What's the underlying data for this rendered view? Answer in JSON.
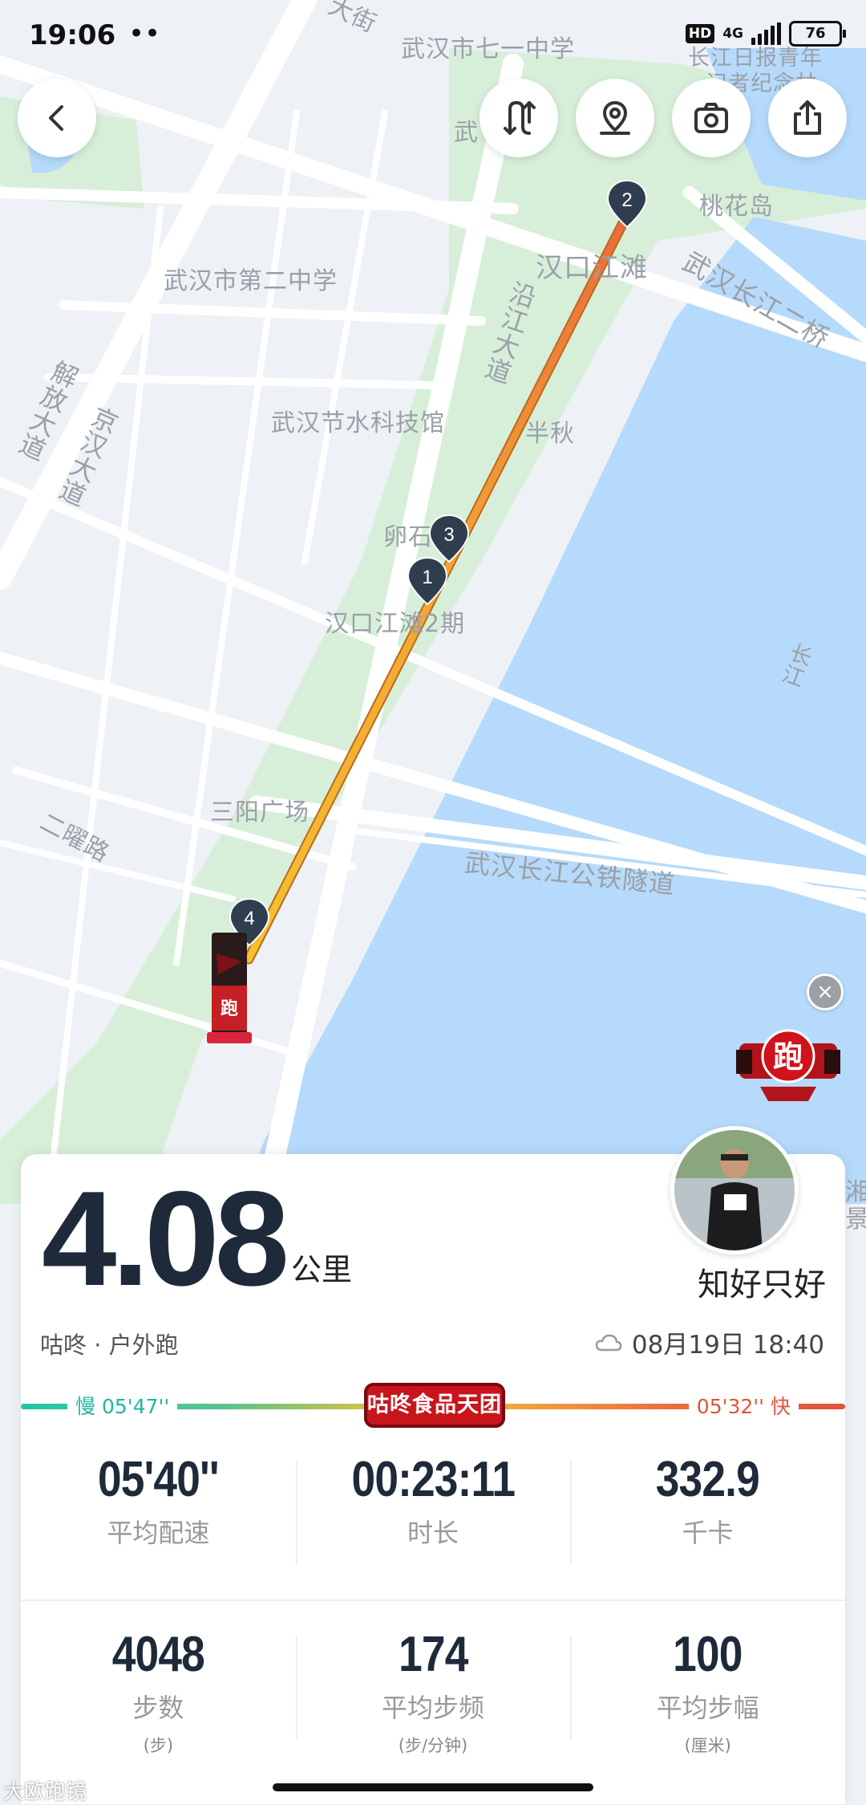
{
  "status_bar": {
    "time": "19:06",
    "dots": "••",
    "hd": "HD",
    "network": "4G",
    "battery": "76"
  },
  "map": {
    "labels": {
      "school_71": "武汉市七一中学",
      "newspaper": "长江日报青年",
      "newspaper2": "记者纪念林",
      "wu_top": "武",
      "street_top": "大街",
      "taohua": "桃花岛",
      "school_2": "武汉市第二中学",
      "jiangtan": "汉口江滩",
      "bridge2": "武汉长江二桥",
      "yanjiang": "沿江大道",
      "water_museum": "武汉节水科技馆",
      "banqiu": "半秋",
      "jiefang": "解放大道",
      "jinghan": "京汉大道",
      "luanshi": "卵石",
      "jiangtan2": "汉口江滩2期",
      "changjiang": "长江",
      "sanyang": "三阳广场",
      "eryao": "二曜路",
      "tunnel": "武汉长江公铁隧道",
      "hu_right": "湘",
      "jing_right": "景"
    },
    "markers": [
      "1",
      "2",
      "3",
      "4"
    ],
    "route_colors": [
      "#f5b62e",
      "#f08a3a",
      "#ec6a3c"
    ]
  },
  "top_buttons": {
    "back": "back-icon",
    "route": "route-icon",
    "location": "location-pin-icon",
    "camera": "camera-icon",
    "share": "share-icon"
  },
  "card": {
    "distance": "4.08",
    "unit": "公里",
    "username": "知好只好",
    "activity": "咕咚 · 户外跑",
    "datetime": "08月19日 18:40",
    "pace_slow": "慢 05'47''",
    "pace_fast": "05'32'' 快",
    "pace_badge": "咕咚食品天团",
    "stats_row1": [
      {
        "value": "05'40''",
        "label": "平均配速"
      },
      {
        "value": "00:23:11",
        "label": "时长"
      },
      {
        "value": "332.9",
        "label": "千卡"
      }
    ],
    "stats_row2": [
      {
        "value": "4048",
        "label": "步数",
        "sub": "(步)"
      },
      {
        "value": "174",
        "label": "平均步频",
        "sub": "(步/分钟)"
      },
      {
        "value": "100",
        "label": "平均步幅",
        "sub": "(厘米)"
      }
    ]
  },
  "floating": {
    "run_badge_text": "跑",
    "close": "×"
  },
  "watermark": "大欧跑镜"
}
